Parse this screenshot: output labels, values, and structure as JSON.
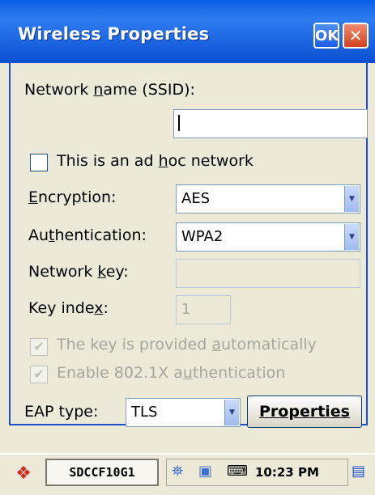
{
  "window": {
    "title": "Wireless Properties",
    "ok_label": "OK",
    "close_glyph": "✕"
  },
  "form": {
    "ssid_label_pre": "Network ",
    "ssid_label_key": "n",
    "ssid_label_post": "ame (SSID):",
    "ssid_value": "",
    "adhoc_label_pre": "This is an ad ",
    "adhoc_label_key": "h",
    "adhoc_label_post": "oc network",
    "encryption_label_key": "E",
    "encryption_label_post": "ncryption:",
    "encryption_value": "AES",
    "auth_label_pre": "Au",
    "auth_label_key": "t",
    "auth_label_post": "hentication:",
    "auth_value": "WPA2",
    "netkey_label_pre": "Network ",
    "netkey_label_key": "k",
    "netkey_label_post": "ey:",
    "netkey_value": "",
    "keyindex_label_pre": "Key inde",
    "keyindex_label_key": "x",
    "keyindex_label_post": ":",
    "keyindex_value": "1",
    "auto_key_label_pre": "The key is provided ",
    "auto_key_label_key": "a",
    "auto_key_label_post": "utomatically",
    "enable_8021x_label_pre": "Enable 802.1X a",
    "enable_8021x_label_key": "u",
    "enable_8021x_label_post": "thentication",
    "eap_label": "EAP type:",
    "eap_value": "TLS",
    "properties_label": "Properties"
  },
  "taskbar": {
    "task_label": "SDCCF10G1",
    "clock": "10:23 PM"
  },
  "icons": {
    "start": "windows-flag-icon",
    "network": "network-icon",
    "connection": "connection-icon",
    "keyboard": "keyboard-icon",
    "desktop": "desktop-switch-icon",
    "checkmark": "checkmark-icon",
    "dropdown": "chevron-down-icon"
  },
  "colors": {
    "title_bar": "#1a63e0",
    "dialog_bg": "#ece9d8",
    "disabled_text": "#a7a69a"
  }
}
